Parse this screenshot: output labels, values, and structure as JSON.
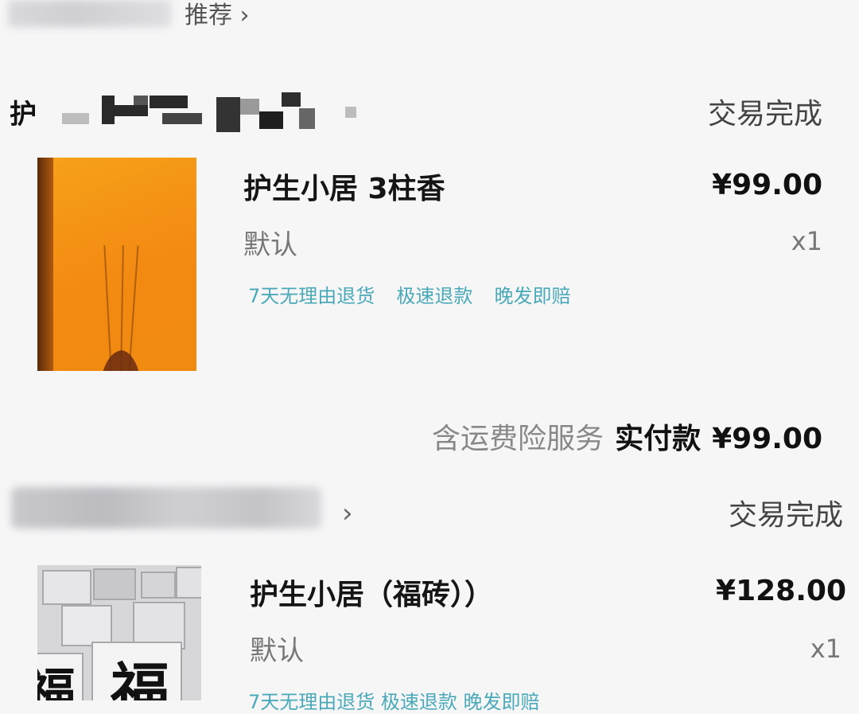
{
  "top": {
    "link_label": "推荐 ›"
  },
  "orders": [
    {
      "shop_prefix": "护",
      "status": "交易完成",
      "item": {
        "title": "护生小居 3柱香",
        "spec": "默认",
        "price": "¥99.00",
        "qty": "x1",
        "tags": [
          "7天无理由退货",
          "极速退款",
          "晚发即赔"
        ]
      },
      "summary": {
        "service_note": "含运费险服务",
        "paid_label": "实付款",
        "paid_value": "¥99.00"
      }
    },
    {
      "shop_chevron": "›",
      "status": "交易完成",
      "item": {
        "title": "护生小居（福砖））",
        "spec": "默认",
        "price": "¥128.00",
        "qty": "x1",
        "tags_partial": "7天无理由退货  极速退款  晚发即赔"
      }
    }
  ],
  "colors": {
    "tag": "#4aa9b8",
    "background": "#f6f6f7",
    "thumbnail_orange": "#f38a12"
  },
  "icons": {
    "chevron": "chevron-right-icon"
  }
}
